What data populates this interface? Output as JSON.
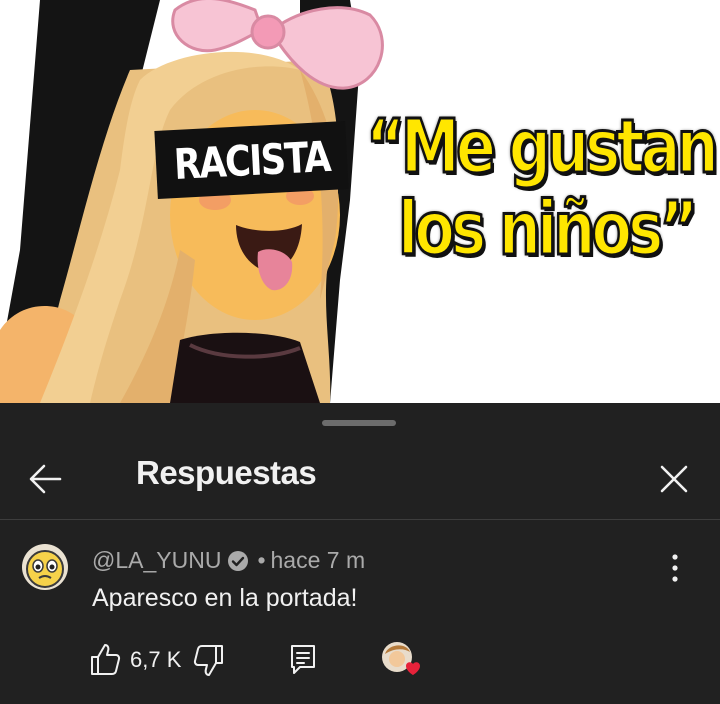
{
  "thumbnail": {
    "label_text": "RACISTA",
    "quote_line1": "“Me gustan",
    "quote_line2": "los niños”",
    "colors": {
      "quote": "#ffe600",
      "bow": "#f6b8cc",
      "hair": "#f2cf92",
      "skin": "#f7bb5a"
    }
  },
  "panel": {
    "title": "Respuestas",
    "back_icon": "arrow-left-icon",
    "close_icon": "close-icon"
  },
  "comment": {
    "author": "@LA_YUNU",
    "verified_icon": "verified-check-icon",
    "separator": "•",
    "time": "hace 7 m",
    "text": "Aparesco en la portada!",
    "likes": "6,7 K",
    "icons": {
      "like": "thumbs-up-icon",
      "dislike": "thumbs-down-icon",
      "reply": "reply-comment-icon",
      "more": "more-vertical-icon",
      "creator_heart": "creator-heart-icon"
    }
  }
}
